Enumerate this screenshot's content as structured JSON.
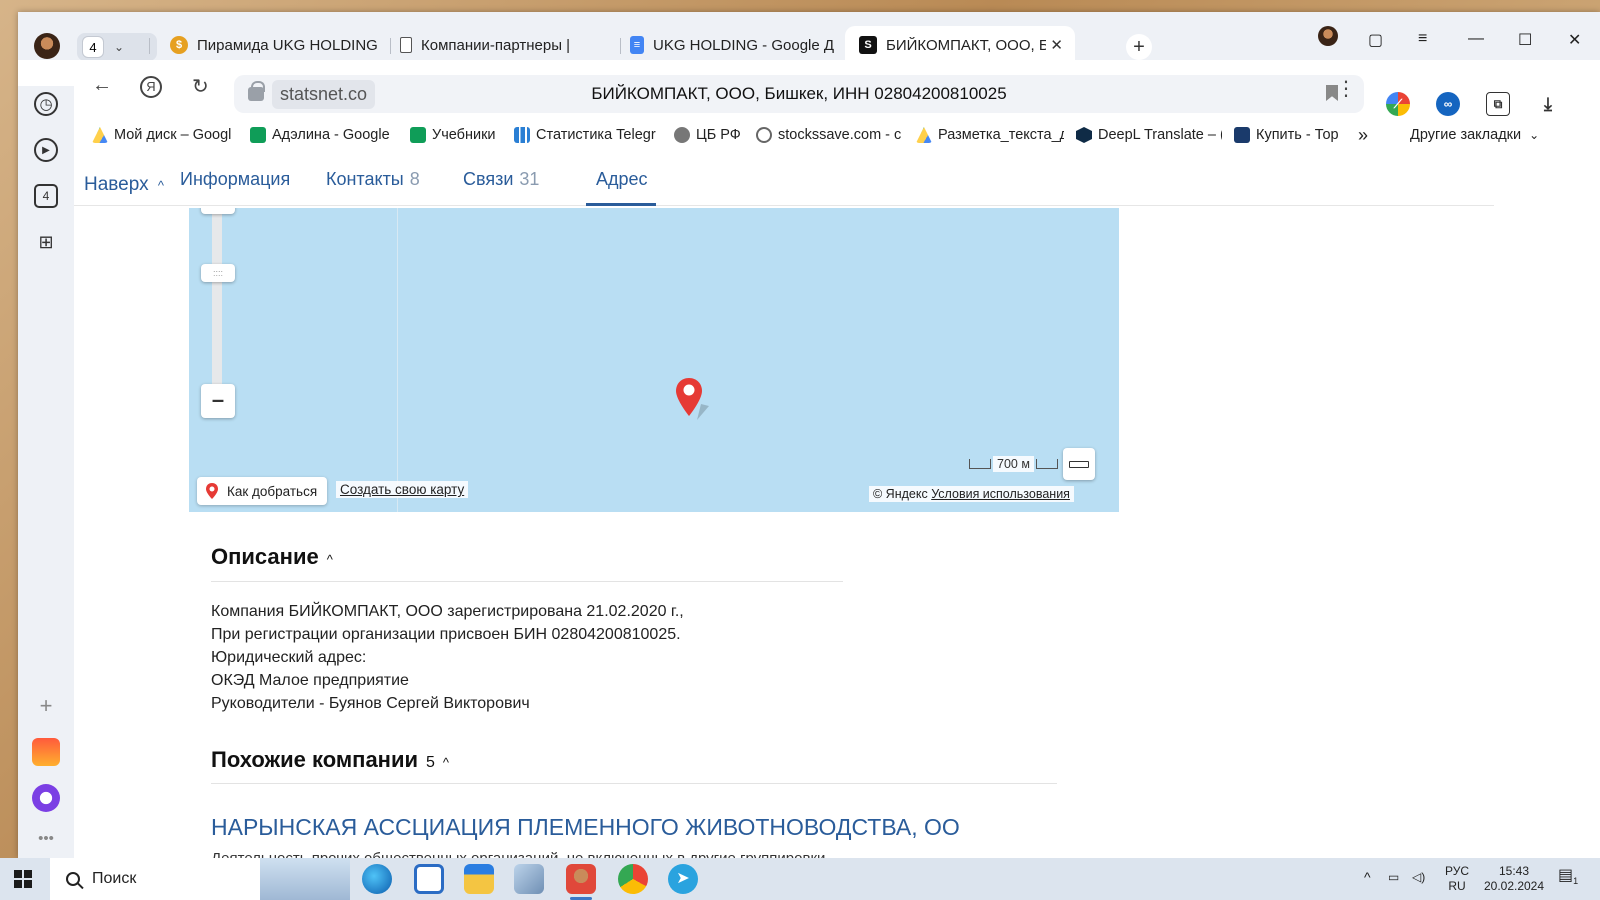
{
  "tabs": {
    "group_count": "4",
    "items": [
      {
        "title": "Пирамида UKG HOLDING",
        "favicon": "coin-icon",
        "color": "#e6a020"
      },
      {
        "title": "Компании-партнеры |",
        "favicon": "document-icon",
        "color": "#555555"
      },
      {
        "title": "UKG HOLDING - Google Д",
        "favicon": "google-docs-icon",
        "color": "#4285f4"
      },
      {
        "title": "БИЙКОМПАКТ, ООО, Б",
        "favicon": "statsnet-icon",
        "color": "#111111",
        "active": true
      }
    ]
  },
  "address": {
    "domain": "statsnet.co",
    "page_title": "БИЙКОМПАКТ, ООО, Бишкек, ИНН 02804200810025"
  },
  "sidebar": {
    "tabs_count": "4"
  },
  "bookmarks": [
    {
      "label": "Мой диск – Googl",
      "icon": "google-drive-icon",
      "color": "#1fa463"
    },
    {
      "label": "Адэлина - Google",
      "icon": "google-sheets-icon",
      "color": "#0f9d58"
    },
    {
      "label": "Учебники",
      "icon": "google-sheets-icon",
      "color": "#0f9d58"
    },
    {
      "label": "Статистика Telegr",
      "icon": "chart-icon",
      "color": "#2a7fd4"
    },
    {
      "label": "ЦБ РФ",
      "icon": "eagle-icon",
      "color": "#555555"
    },
    {
      "label": "stockssave.com - c",
      "icon": "globe-icon",
      "color": "#666666"
    },
    {
      "label": "Разметка_текста_д",
      "icon": "google-drive-icon",
      "color": "#1fa463"
    },
    {
      "label": "DeepL Translate – (",
      "icon": "deepl-icon",
      "color": "#0f2b46"
    },
    {
      "label": "Купить - Тор",
      "icon": "shop-icon",
      "color": "#1a3a6b"
    }
  ],
  "bookmarks_more": "»",
  "bookmarks_other": "Другие закладки",
  "subnav": {
    "up_label": "Наверх",
    "items": [
      {
        "label": "Информация",
        "count": ""
      },
      {
        "label": "Контакты",
        "count": "8"
      },
      {
        "label": "Связи",
        "count": "31"
      },
      {
        "label": "Адрес",
        "count": "",
        "active": true
      }
    ]
  },
  "map": {
    "route_button": "Как добраться",
    "create_map": "Создать свою карту",
    "scale_label": "700 м",
    "copyright_prefix": "© Яндекс",
    "terms_link": "Условия использования"
  },
  "description": {
    "heading": "Описание",
    "lines": [
      "Компания БИЙКОМПАКТ, ООО зарегистрирована 21.02.2020 г.,",
      "При регистрации организации присвоен БИН 02804200810025.",
      "Юридический адрес:",
      "ОКЭД Малое предприятие",
      "Руководители - Буянов Сергей Викторович"
    ]
  },
  "similar": {
    "heading": "Похожие компании",
    "count": "5",
    "first_company": "НАРЫНСКАЯ АССЦИАЦИЯ ПЛЕМЕННОГО ЖИВОТНОВОДСТВА, ОО",
    "first_company_desc": "Деятельность прочих общественных организаций, не включенных в другие группировки"
  },
  "taskbar": {
    "search_label": "Поиск",
    "lang_top": "РУС",
    "lang_bottom": "RU",
    "time": "15:43",
    "date": "20.02.2024",
    "notif_count": "1"
  }
}
